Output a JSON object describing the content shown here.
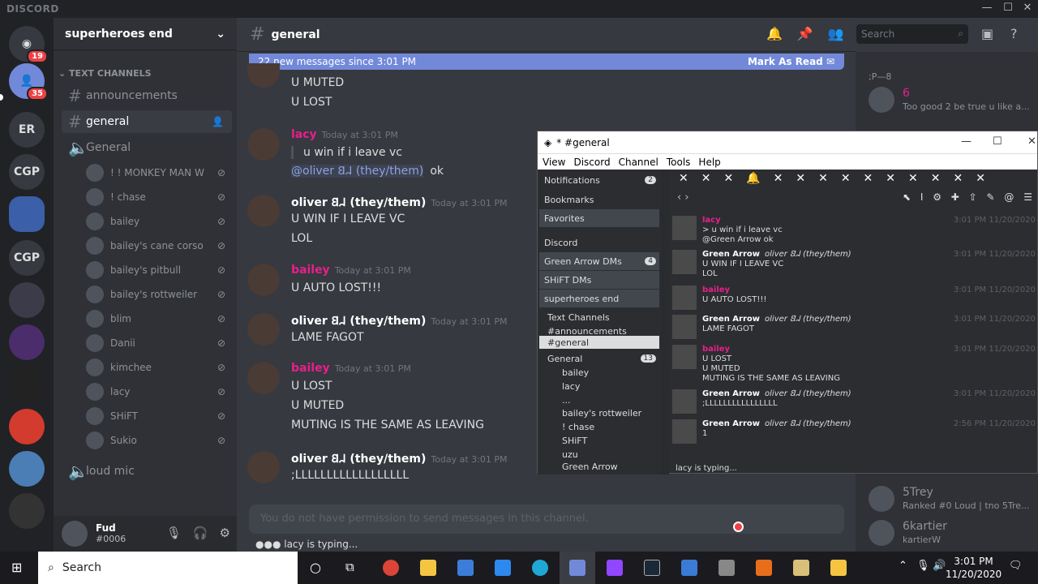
{
  "app": {
    "brand": "DISCORD"
  },
  "guilds": {
    "home_badge": "19",
    "friends_badge": "35",
    "items": [
      "ER",
      "CGP",
      "CGP"
    ]
  },
  "server": {
    "name": "superheroes end"
  },
  "sidebar": {
    "category": "TEXT CHANNELS",
    "text_channels": [
      {
        "name": "announcements"
      },
      {
        "name": "general"
      }
    ],
    "voice_channels": [
      {
        "name": "General"
      },
      {
        "name": "loud mic"
      }
    ],
    "voice_users": [
      "! ! MONKEY MAN W",
      "! chase",
      "bailey",
      "bailey's cane corso",
      "bailey's pitbull",
      "bailey's rottweiler",
      "blim",
      "Danii",
      "kimchee",
      "lacy",
      "SHiFT",
      "Sukio"
    ]
  },
  "user_panel": {
    "name": "Fud",
    "tag": "#0006"
  },
  "chat": {
    "channel": "general",
    "search_placeholder": "Search",
    "new_messages": "22 new messages since 3:01 PM",
    "mark_as_read": "Mark As Read",
    "input_placeholder": "You do not have permission to send messages in this channel.",
    "typing": "lacy is typing...",
    "lines_top": [
      "U MUTED",
      "U LOST"
    ],
    "messages": [
      {
        "author": "lacy",
        "color": "#e91e8c",
        "time": "Today at 3:01 PM",
        "lines": [
          "u win if i leave vc"
        ],
        "mention": "@oliver 𐐒𐐇 (they/them)",
        "after_mention": "ok"
      },
      {
        "author": "oliver 𐐒𐐇 (they/them)",
        "color": "#ffffff",
        "time": "Today at 3:01 PM",
        "lines": [
          "U WIN IF I LEAVE VC",
          "LOL"
        ]
      },
      {
        "author": "bailey",
        "color": "#e91e8c",
        "time": "Today at 3:01 PM",
        "lines": [
          "U AUTO LOST!!!"
        ]
      },
      {
        "author": "oliver 𐐒𐐇 (they/them)",
        "color": "#ffffff",
        "time": "Today at 3:01 PM",
        "lines": [
          "LAME FAGOT"
        ]
      },
      {
        "author": "bailey",
        "color": "#e91e8c",
        "time": "Today at 3:01 PM",
        "lines": [
          "U LOST",
          "U MUTED",
          "MUTING IS THE SAME AS LEAVING"
        ]
      },
      {
        "author": "oliver 𐐒𐐇 (they/them)",
        "color": "#ffffff",
        "time": "Today at 3:01 PM",
        "lines": [
          ";LLLLLLLLLLLLLLLLLL"
        ]
      }
    ]
  },
  "members": {
    "header": ";P—8",
    "top_item": {
      "name": "6",
      "status": "Too good 2 be true u like a..."
    },
    "items": [
      {
        "name": "5Trey",
        "status": "Ranked #0 Loud | tno 5Tre..."
      },
      {
        "name": "6kartier",
        "status": "kartierW"
      }
    ]
  },
  "popup": {
    "title": "* #general",
    "menu": [
      "View",
      "Discord",
      "Channel",
      "Tools",
      "Help"
    ],
    "sidebar": [
      {
        "label": "Notifications",
        "count": "2"
      },
      {
        "label": "Bookmarks"
      },
      {
        "label": "Favorites"
      },
      {
        "label": "Discord"
      },
      {
        "label": "Green Arrow DMs",
        "count": "4"
      },
      {
        "label": "SHiFT DMs"
      },
      {
        "label": "superheroes end"
      },
      {
        "label": "Text Channels"
      },
      {
        "label": "#announcements"
      },
      {
        "label": "#general"
      },
      {
        "label": "General",
        "count": "13"
      },
      {
        "label": "bailey"
      },
      {
        "label": "lacy"
      },
      {
        "label": "..."
      },
      {
        "label": "bailey's rottweiler"
      },
      {
        "label": "! chase"
      },
      {
        "label": "SHiFT"
      },
      {
        "label": "uzu"
      },
      {
        "label": "Green Arrow"
      }
    ],
    "messages": [
      {
        "author": "lacy",
        "color": "#e91e8c",
        "lines": [
          "> u win if i leave vc",
          "@Green Arrow ok"
        ],
        "time": "3:01 PM 11/20/2020"
      },
      {
        "author": "Green Arrow",
        "nick": "oliver 𐐒𐐇 (they/them)",
        "color": "#ffffff",
        "lines": [
          "U WIN IF I LEAVE VC",
          "LOL"
        ],
        "time": "3:01 PM 11/20/2020"
      },
      {
        "author": "bailey",
        "color": "#e91e8c",
        "lines": [
          "U AUTO LOST!!!"
        ],
        "time": "3:01 PM 11/20/2020"
      },
      {
        "author": "Green Arrow",
        "nick": "oliver 𐐒𐐇 (they/them)",
        "color": "#ffffff",
        "lines": [
          "LAME FAGOT"
        ],
        "time": "3:01 PM 11/20/2020"
      },
      {
        "author": "bailey",
        "color": "#e91e8c",
        "lines": [
          "U LOST",
          "U MUTED",
          "MUTING IS THE SAME AS LEAVING"
        ],
        "time": "3:01 PM 11/20/2020"
      },
      {
        "author": "Green Arrow",
        "nick": "oliver 𐐒𐐇 (they/them)",
        "color": "#ffffff",
        "lines": [
          ";LLLLLLLLLLLLLLLL"
        ],
        "time": "3:01 PM 11/20/2020"
      },
      {
        "author": "Green Arrow",
        "nick": "oliver 𐐒𐐇 (they/them)",
        "color": "#ffffff",
        "lines": [
          "1"
        ],
        "time": "2:56 PM 11/20/2020"
      }
    ],
    "typing": "lacy is typing..."
  },
  "taskbar": {
    "search": "Search",
    "time": "3:01 PM",
    "date": "11/20/2020"
  }
}
